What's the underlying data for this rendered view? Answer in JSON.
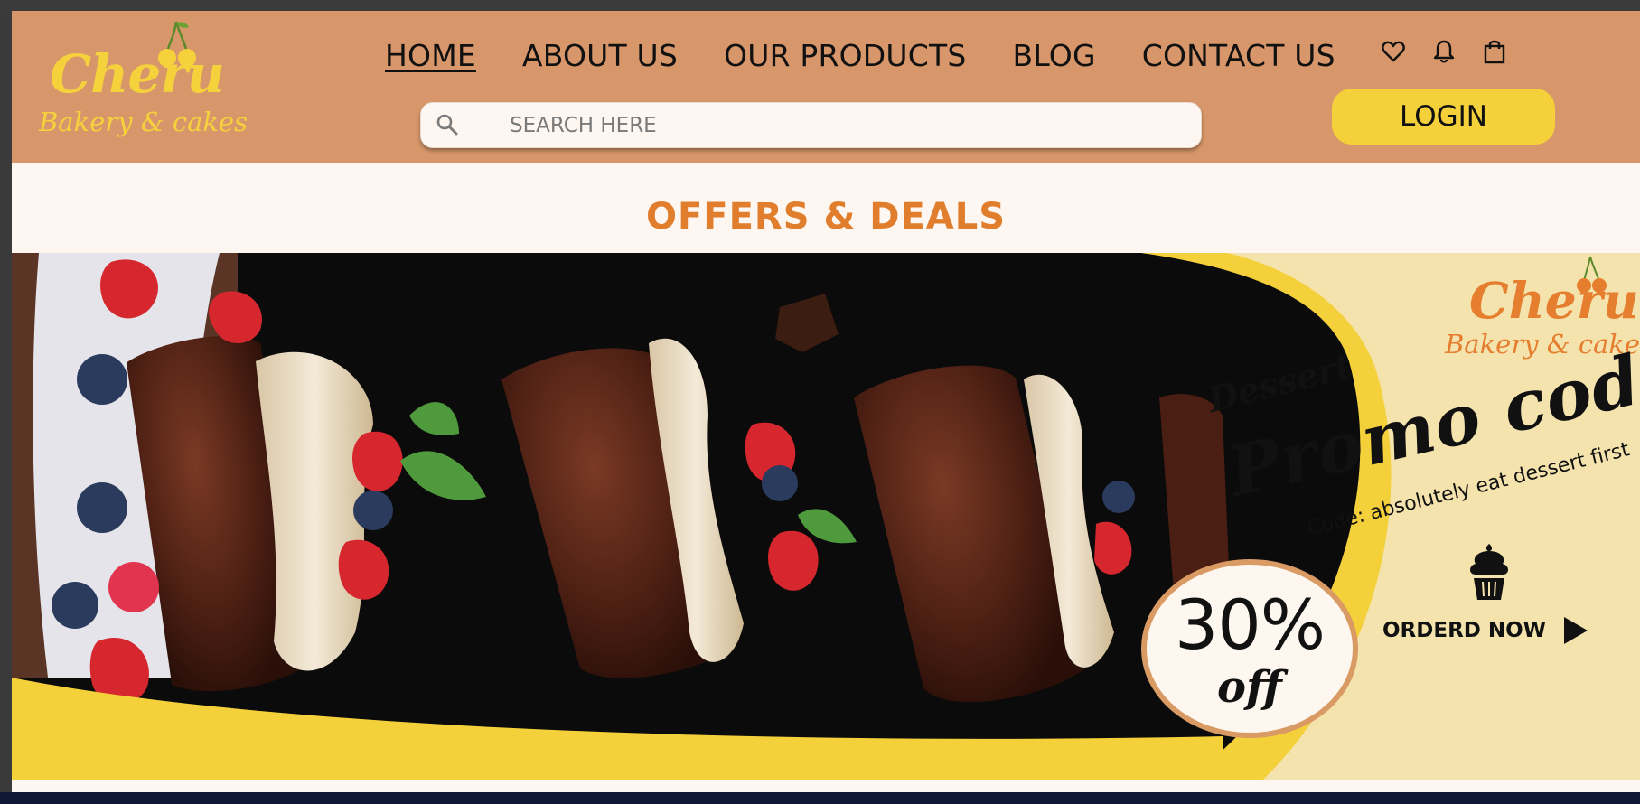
{
  "brand": {
    "name": "Cheru",
    "tagline": "Bakery & cakes"
  },
  "nav": {
    "items": [
      {
        "label": "HOME",
        "active": true
      },
      {
        "label": "ABOUT US",
        "active": false
      },
      {
        "label": "OUR PRODUCTS",
        "active": false
      },
      {
        "label": "BLOG",
        "active": false
      },
      {
        "label": "CONTACT US",
        "active": false
      }
    ]
  },
  "header_icons": [
    "heart-icon",
    "bell-icon",
    "shopping-bag-icon"
  ],
  "search": {
    "placeholder": "SEARCH HERE",
    "value": ""
  },
  "login_label": "LOGIN",
  "section_title": "OFFERS & DEALS",
  "promo": {
    "brand_name": "Cheru",
    "brand_tagline": "Bakery & cakes",
    "dessert": "Dessert",
    "headline": "Promo code",
    "code_text": "Code: absolutely eat dessert first",
    "order_label": "ORDERD NOW",
    "discount": "30%",
    "discount_suffix": "off"
  },
  "colors": {
    "header_bg": "#d8976a",
    "accent_yellow": "#f4d03a",
    "accent_orange": "#e07e2e",
    "page_bg": "#fef6f0",
    "promo_panel": "#f4e3ad"
  }
}
